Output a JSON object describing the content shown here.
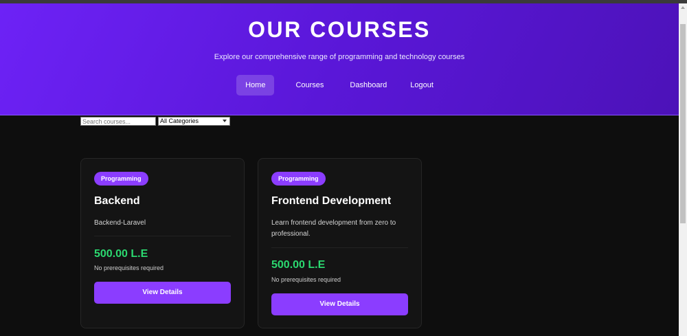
{
  "header": {
    "title": "OUR COURSES",
    "subtitle": "Explore our comprehensive range of programming and technology courses"
  },
  "nav": {
    "items": [
      {
        "label": "Home",
        "active": true
      },
      {
        "label": "Courses",
        "active": false
      },
      {
        "label": "Dashboard",
        "active": false
      },
      {
        "label": "Logout",
        "active": false
      }
    ]
  },
  "filters": {
    "search_placeholder": "Search courses...",
    "category_selected": "All Categories"
  },
  "courses": [
    {
      "category": "Programming",
      "title": "Backend",
      "description": "Backend-Laravel",
      "price": "500.00 L.E",
      "prerequisites": "No prerequisites required",
      "button_label": "View Details"
    },
    {
      "category": "Programming",
      "title": "Frontend Development",
      "description": "Learn frontend development from zero to professional.",
      "price": "500.00 L.E",
      "prerequisites": "No prerequisites required",
      "button_label": "View Details"
    }
  ],
  "colors": {
    "accent": "#8b3dff",
    "price": "#2bd970",
    "header_start": "#6d22f6",
    "header_end": "#4c12b8",
    "background": "#0e0e0e"
  }
}
